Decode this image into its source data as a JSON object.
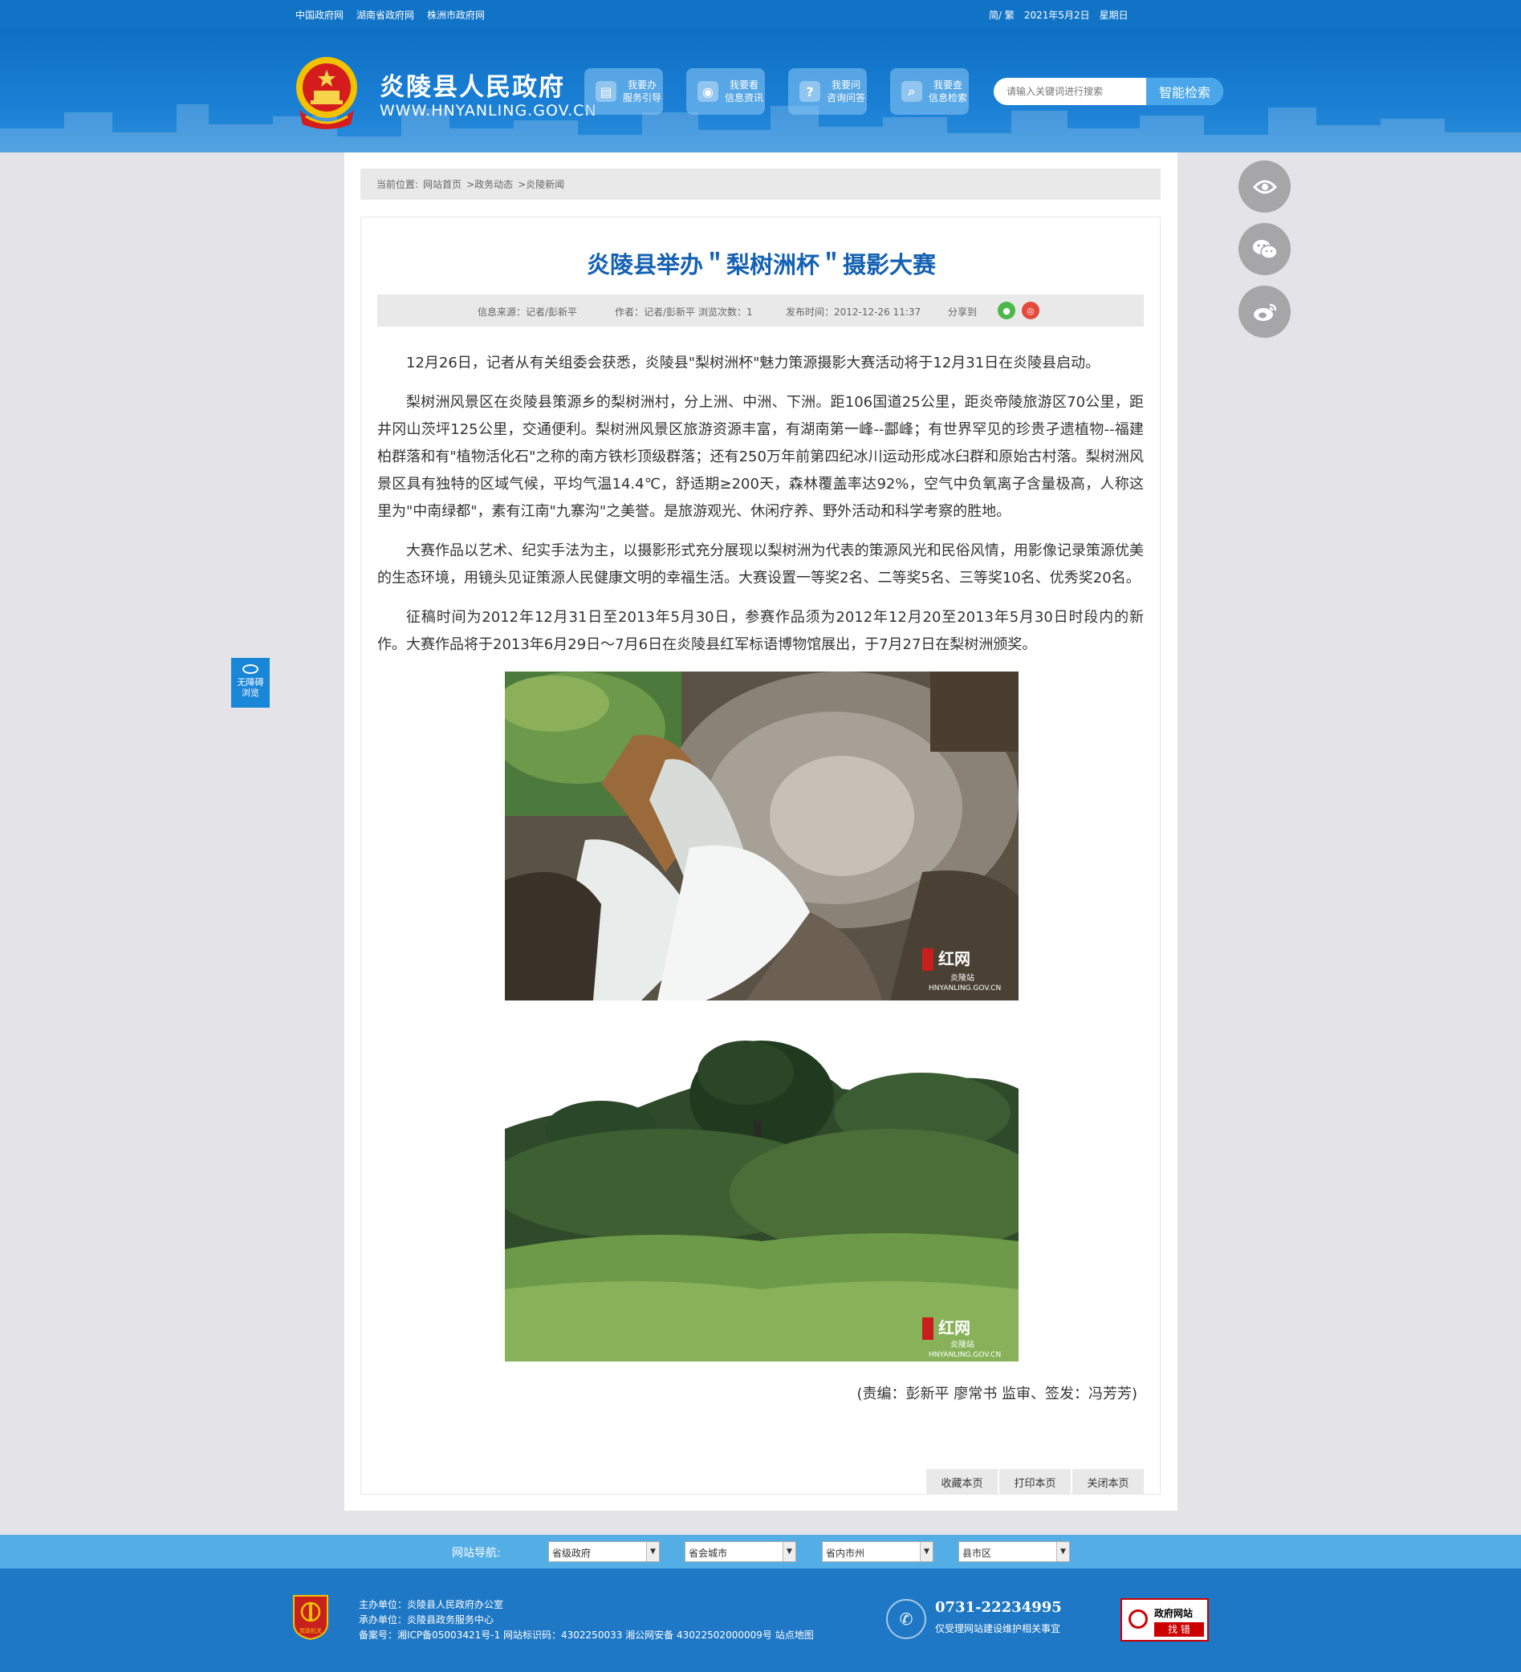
{
  "topbar": {
    "links": [
      "中国政府网",
      "湖南省政府网",
      "株洲市政府网"
    ],
    "lang": "简/ 繁",
    "date": "2021年5月2日",
    "weekday": "星期日"
  },
  "header": {
    "site_title": "炎陵县人民政府",
    "site_url": "WWW.HNYANLING.GOV.CN",
    "quick_buttons": [
      {
        "icon": "document-icon",
        "line1": "我要办",
        "line2": "服务引导"
      },
      {
        "icon": "eye-icon",
        "line1": "我要看",
        "line2": "信息资讯"
      },
      {
        "icon": "question-icon",
        "line1": "我要问",
        "line2": "咨询问答"
      },
      {
        "icon": "search-icon",
        "line1": "我要查",
        "line2": "信息检索"
      }
    ],
    "search_placeholder": "请输入关键词进行搜索",
    "search_button": "智能检索"
  },
  "breadcrumb": {
    "prefix": "当前位置:",
    "items": [
      "网站首页",
      ">政务动态",
      ">炎陵新闻"
    ]
  },
  "article": {
    "title": "炎陵县举办＂梨树洲杯＂摄影大赛",
    "meta": {
      "source": "信息来源：记者/彭新平",
      "author": "作者：记者/彭新平",
      "views": "浏览次数：1",
      "published": "发布时间：2012-12-26 11:37",
      "share": "分享到"
    },
    "paragraphs": [
      "12月26日，记者从有关组委会获悉，炎陵县\"梨树洲杯\"魅力策源摄影大赛活动将于12月31日在炎陵县启动。",
      "梨树洲风景区在炎陵县策源乡的梨树洲村，分上洲、中洲、下洲。距106国道25公里，距炎帝陵旅游区70公里，距井冈山茨坪125公里，交通便利。梨树洲风景区旅游资源丰富，有湖南第一峰--酃峰；有世界罕见的珍贵孑遗植物--福建柏群落和有\"植物活化石\"之称的南方铁杉顶级群落；还有250万年前第四纪冰川运动形成冰臼群和原始古村落。梨树洲风景区具有独特的区域气候，平均气温14.4℃，舒适期≥200天，森林覆盖率达92%，空气中负氧离子含量极高，人称这里为\"中南绿都\"，素有江南\"九寨沟\"之美誉。是旅游观光、休闲疗养、野外活动和科学考察的胜地。",
      "大赛作品以艺术、纪实手法为主，以摄影形式充分展现以梨树洲为代表的策源风光和民俗风情，用影像记录策源优美的生态环境，用镜头见证策源人民健康文明的幸福生活。大赛设置一等奖2名、二等奖5名、三等奖10名、优秀奖20名。",
      "征稿时间为2012年12月31日至2013年5月30日，参赛作品须为2012年12月20至2013年5月30日时段内的新作。大赛作品将于2013年6月29日～7月6日在炎陵县红军标语博物馆展出，于7月27日在梨树洲颁奖。"
    ],
    "watermark_1": "红网",
    "watermark_1_sub": "炎陵站",
    "watermark_url": "HNYANLING.GOV.CN",
    "credit": "(责编：彭新平 廖常书 监审、签发：冯芳芳)",
    "actions": [
      "收藏本页",
      "打印本页",
      "关闭本页"
    ]
  },
  "side": {
    "accessibility_line1": "无障碍",
    "accessibility_line2": "浏览"
  },
  "footer_nav": {
    "label": "网站导航:",
    "selects": [
      "省级政府",
      "省会城市",
      "省内市州",
      "县市区"
    ]
  },
  "footer": {
    "badge_text": "党政机关",
    "host": "主办单位：炎陵县人民政府办公室",
    "operator": "承办单位：炎陵县政务服务中心",
    "record": "备案号：湘ICP备05003421号-1 网站标识码：4302250033 湘公网安备 43022502000009号 站点地图",
    "phone": "0731-22234995",
    "phone_sub": "仅受理网站建设维护相关事宜",
    "findbug_line1": "政府网站",
    "findbug_line2": "找 错"
  },
  "colors": {
    "topbar": "#1173c6",
    "title": "#1461b3",
    "footer": "#1f78c5",
    "footer_nav": "#53aee5"
  }
}
